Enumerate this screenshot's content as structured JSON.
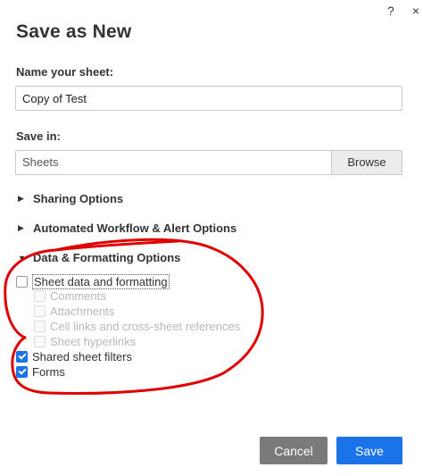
{
  "window": {
    "help_glyph": "?",
    "close_glyph": "×"
  },
  "dialog": {
    "title": "Save as New"
  },
  "name_field": {
    "label": "Name your sheet:",
    "value": "Copy of Test"
  },
  "save_in": {
    "label": "Save in:",
    "value": "Sheets",
    "browse_label": "Browse"
  },
  "sections": {
    "sharing": {
      "label": "Sharing Options",
      "expanded": false
    },
    "workflow": {
      "label": "Automated Workflow & Alert Options",
      "expanded": false
    },
    "data_formatting": {
      "label": "Data & Formatting Options",
      "expanded": true
    }
  },
  "options": {
    "sheet_data": {
      "label": "Sheet data and formatting",
      "checked": false,
      "enabled": true
    },
    "comments": {
      "label": "Comments",
      "checked": false,
      "enabled": false
    },
    "attachments": {
      "label": "Attachments",
      "checked": false,
      "enabled": false
    },
    "cell_links": {
      "label": "Cell links and cross-sheet references",
      "checked": false,
      "enabled": false
    },
    "hyperlinks": {
      "label": "Sheet hyperlinks",
      "checked": false,
      "enabled": false
    },
    "shared_filters": {
      "label": "Shared sheet filters",
      "checked": true,
      "enabled": true
    },
    "forms": {
      "label": "Forms",
      "checked": true,
      "enabled": true
    }
  },
  "footer": {
    "cancel_label": "Cancel",
    "save_label": "Save"
  },
  "colors": {
    "primary": "#1a73e8",
    "cancel": "#7a7a7a",
    "annotation": "#e00000"
  }
}
